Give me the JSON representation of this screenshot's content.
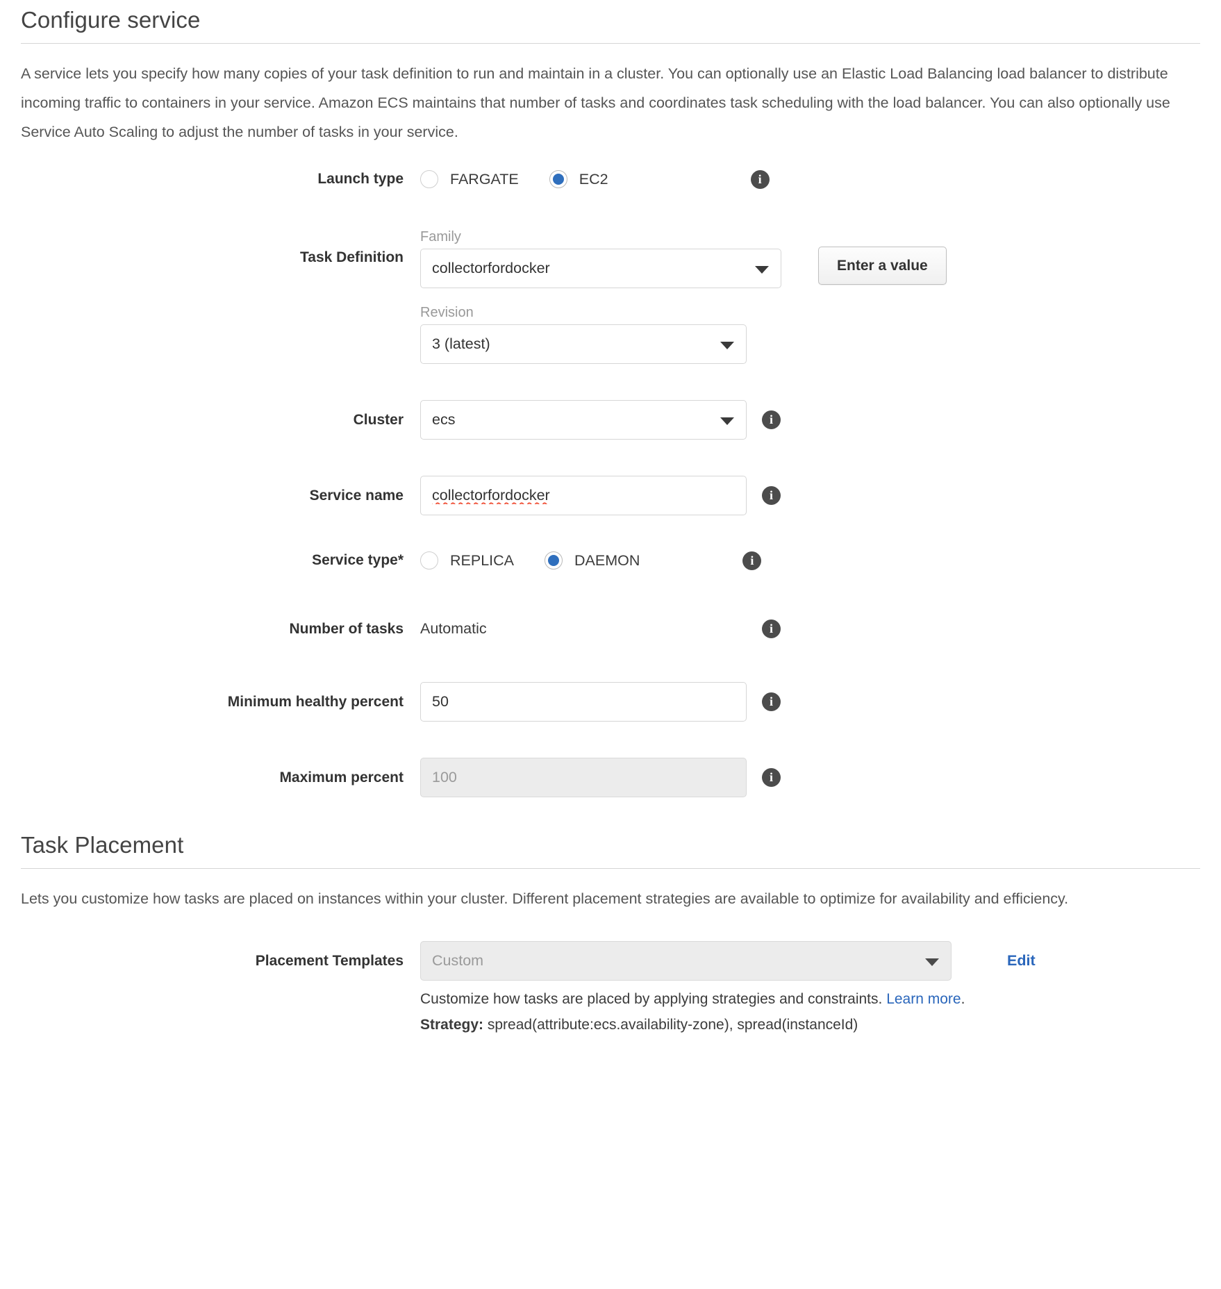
{
  "sections": {
    "configure_service": {
      "title": "Configure service",
      "description": "A service lets you specify how many copies of your task definition to run and maintain in a cluster. You can optionally use an Elastic Load Balancing load balancer to distribute incoming traffic to containers in your service. Amazon ECS maintains that number of tasks and coordinates task scheduling with the load balancer. You can also optionally use Service Auto Scaling to adjust the number of tasks in your service."
    },
    "task_placement": {
      "title": "Task Placement",
      "description": "Lets you customize how tasks are placed on instances within your cluster. Different placement strategies are available to optimize for availability and efficiency."
    }
  },
  "fields": {
    "launch_type": {
      "label": "Launch type",
      "options": [
        {
          "value": "FARGATE",
          "selected": false
        },
        {
          "value": "EC2",
          "selected": true
        }
      ],
      "info": "info-icon"
    },
    "task_definition": {
      "label": "Task Definition",
      "family": {
        "sub_label": "Family",
        "value": "collectorfordocker"
      },
      "revision": {
        "sub_label": "Revision",
        "value": "3 (latest)"
      },
      "button": "Enter a value"
    },
    "cluster": {
      "label": "Cluster",
      "value": "ecs"
    },
    "service_name": {
      "label": "Service name",
      "value": "collectorfordocker"
    },
    "service_type": {
      "label": "Service type*",
      "options": [
        {
          "value": "REPLICA",
          "selected": false
        },
        {
          "value": "DAEMON",
          "selected": true
        }
      ]
    },
    "number_of_tasks": {
      "label": "Number of tasks",
      "value": "Automatic"
    },
    "minimum_healthy_percent": {
      "label": "Minimum healthy percent",
      "value": "50"
    },
    "maximum_percent": {
      "label": "Maximum percent",
      "placeholder": "100",
      "disabled": true
    },
    "placement_templates": {
      "label": "Placement Templates",
      "value": "Custom",
      "disabled": true,
      "edit_link": "Edit",
      "help_prefix": "Customize how tasks are placed by applying strategies and constraints. ",
      "help_link": "Learn more",
      "help_suffix": ".",
      "strategy_label": "Strategy:",
      "strategy_value": "spread(attribute:ecs.availability-zone), spread(instanceId)"
    }
  },
  "colors": {
    "accent_blue": "#2a66bb",
    "radio_blue": "#2f6fbd",
    "info_dark": "#4c4c4c",
    "spellcheck_red": "#f0573f"
  }
}
